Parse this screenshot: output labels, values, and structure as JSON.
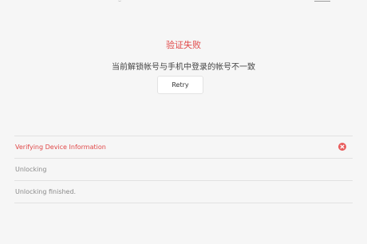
{
  "colors": {
    "error": "#e04848",
    "background": "#f6f6f6"
  },
  "error": {
    "title": "验证失败",
    "message": "当前解锁帐号与手机中登录的帐号不一致",
    "retry_label": "Retry"
  },
  "steps": [
    {
      "label": "Verifying Device Information",
      "status": "failed",
      "icon": "error-x-circle-icon"
    },
    {
      "label": "Unlocking",
      "status": "pending"
    },
    {
      "label": "Unlocking finished.",
      "status": "pending"
    }
  ]
}
